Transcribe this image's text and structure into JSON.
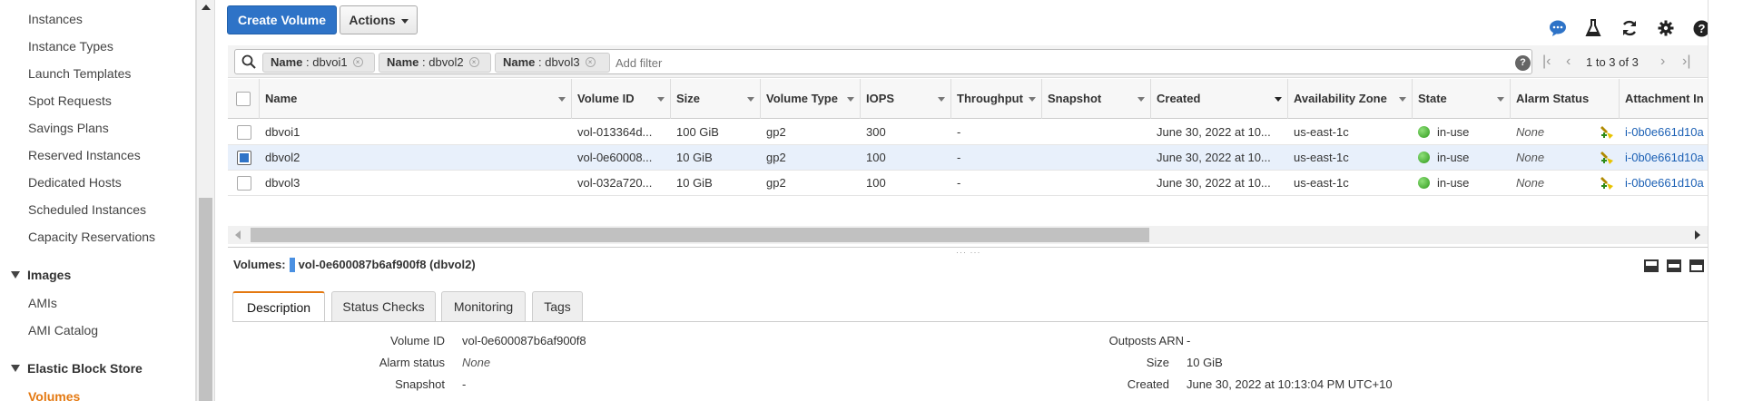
{
  "sidebar": {
    "items": [
      {
        "label": "Instances"
      },
      {
        "label": "Instance Types"
      },
      {
        "label": "Launch Templates"
      },
      {
        "label": "Spot Requests"
      },
      {
        "label": "Savings Plans"
      },
      {
        "label": "Reserved Instances"
      },
      {
        "label": "Dedicated Hosts"
      },
      {
        "label": "Scheduled Instances"
      },
      {
        "label": "Capacity Reservations"
      }
    ],
    "images_section": "Images",
    "images_items": [
      {
        "label": "AMIs"
      },
      {
        "label": "AMI Catalog"
      }
    ],
    "ebs_section": "Elastic Block Store",
    "ebs_items": [
      {
        "label": "Volumes"
      }
    ]
  },
  "toolbar": {
    "create_label": "Create Volume",
    "actions_label": "Actions"
  },
  "filters": {
    "chips": [
      {
        "key": "Name",
        "value": ": dbvoi1"
      },
      {
        "key": "Name",
        "value": ": dbvol2"
      },
      {
        "key": "Name",
        "value": ": dbvol3"
      }
    ],
    "placeholder": "Add filter",
    "pager": "1 to 3 of 3"
  },
  "table": {
    "columns": [
      "Name",
      "Volume ID",
      "Size",
      "Volume Type",
      "IOPS",
      "Throughput",
      "Snapshot",
      "Created",
      "Availability Zone",
      "State",
      "Alarm Status",
      "Attachment In"
    ],
    "rows": [
      {
        "name": "dbvoi1",
        "volume_id": "vol-013364d...",
        "size": "100 GiB",
        "type": "gp2",
        "iops": "300",
        "throughput": "-",
        "snapshot": "",
        "created": "June 30, 2022 at 10...",
        "az": "us-east-1c",
        "state": "in-use",
        "alarm": "None",
        "attachment": "i-0b0e661d10a",
        "selected": false
      },
      {
        "name": "dbvol2",
        "volume_id": "vol-0e60008...",
        "size": "10 GiB",
        "type": "gp2",
        "iops": "100",
        "throughput": "-",
        "snapshot": "",
        "created": "June 30, 2022 at 10...",
        "az": "us-east-1c",
        "state": "in-use",
        "alarm": "None",
        "attachment": "i-0b0e661d10a",
        "selected": true
      },
      {
        "name": "dbvol3",
        "volume_id": "vol-032a720...",
        "size": "10 GiB",
        "type": "gp2",
        "iops": "100",
        "throughput": "-",
        "snapshot": "",
        "created": "June 30, 2022 at 10...",
        "az": "us-east-1c",
        "state": "in-use",
        "alarm": "None",
        "attachment": "i-0b0e661d10a",
        "selected": false
      }
    ]
  },
  "detail": {
    "prefix": "Volumes:",
    "title": "vol-0e600087b6af900f8 (dbvol2)",
    "tabs": [
      "Description",
      "Status Checks",
      "Monitoring",
      "Tags"
    ],
    "left": [
      {
        "label": "Volume ID",
        "value": "vol-0e600087b6af900f8",
        "italic": false
      },
      {
        "label": "Alarm status",
        "value": "None",
        "italic": true
      },
      {
        "label": "Snapshot",
        "value": "-",
        "italic": false
      }
    ],
    "right": [
      {
        "label": "Outposts ARN",
        "value": "-"
      },
      {
        "label": "Size",
        "value": "10 GiB"
      },
      {
        "label": "Created",
        "value": "June 30, 2022 at 10:13:04 PM UTC+10"
      }
    ]
  },
  "colors": {
    "primary": "#2e73c7",
    "accent": "#e47911",
    "link": "#1a5fb4",
    "ok": "#2f9a1c"
  }
}
